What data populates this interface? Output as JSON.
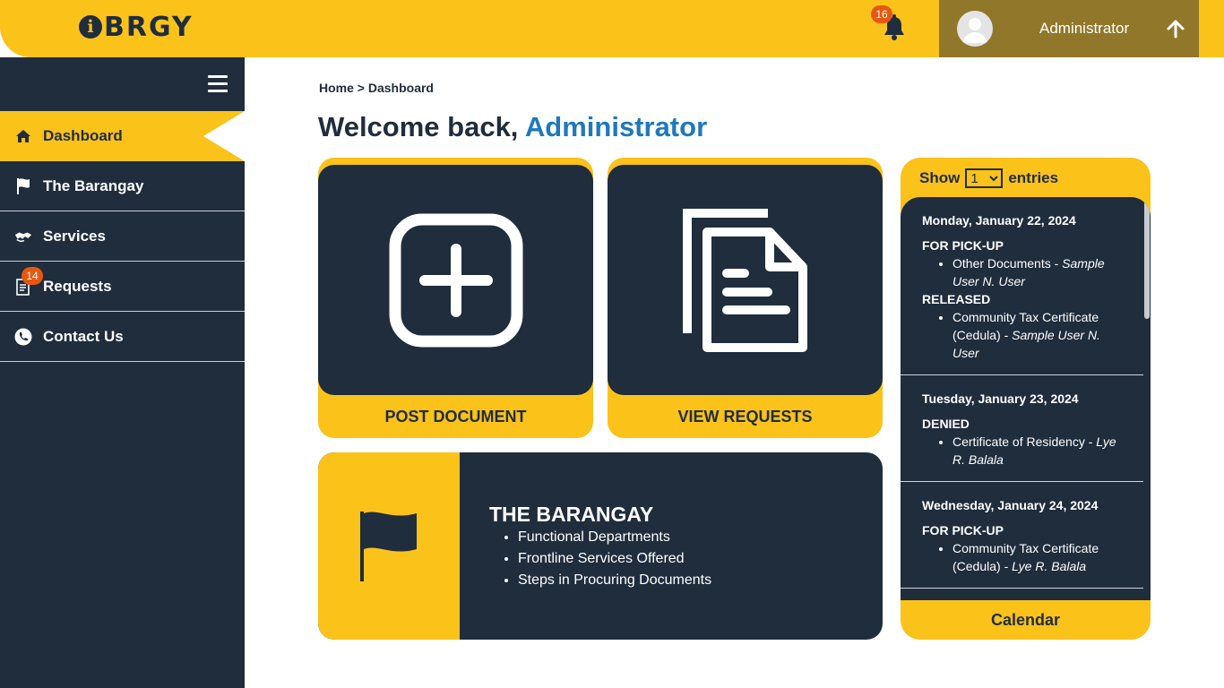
{
  "header": {
    "logo_text": "BRGY",
    "logo_letter": "i",
    "notification_count": "16",
    "user_name": "Administrator"
  },
  "sidebar": {
    "items": [
      {
        "label": "Dashboard",
        "icon": "home-icon",
        "active": true
      },
      {
        "label": "The Barangay",
        "icon": "flag-icon"
      },
      {
        "label": "Services",
        "icon": "handshake-icon"
      },
      {
        "label": "Requests",
        "icon": "document-icon",
        "badge": "14"
      },
      {
        "label": "Contact Us",
        "icon": "phone-icon"
      }
    ]
  },
  "main": {
    "breadcrumb": "Home > Dashboard",
    "welcome_prefix": "Welcome back, ",
    "welcome_name": "Administrator",
    "post_document_label": "POST DOCUMENT",
    "view_requests_label": "VIEW REQUESTS",
    "barangay": {
      "title": "THE BARANGAY",
      "items": [
        "Functional Departments",
        "Frontline Services Offered",
        "Steps in Procuring Documents"
      ]
    }
  },
  "panel": {
    "show_label": "Show",
    "entries_label": "entries",
    "entries_value": "1",
    "calendar_label": "Calendar",
    "days": [
      {
        "date": "Monday, January 22, 2024",
        "groups": [
          {
            "status": "FOR PICK-UP",
            "items": [
              {
                "doc": "Other Documents - ",
                "who": "Sample User N. User"
              }
            ]
          },
          {
            "status": "RELEASED",
            "items": [
              {
                "doc": "Community Tax Certificate (Cedula) - ",
                "who": "Sample User N. User"
              }
            ]
          }
        ]
      },
      {
        "date": "Tuesday, January 23, 2024",
        "groups": [
          {
            "status": "DENIED",
            "items": [
              {
                "doc": "Certificate of Residency - ",
                "who": "Lye R. Balala"
              }
            ]
          }
        ]
      },
      {
        "date": "Wednesday, January 24, 2024",
        "groups": [
          {
            "status": "FOR PICK-UP",
            "items": [
              {
                "doc": "Community Tax Certificate (Cedula) - ",
                "who": "Lye R. Balala"
              }
            ]
          }
        ]
      }
    ]
  },
  "colors": {
    "accent": "#fbc21a",
    "navy": "#1f2d3d",
    "user_bar": "#91772a",
    "badge": "#e8570e",
    "link_blue": "#1f78bd"
  }
}
